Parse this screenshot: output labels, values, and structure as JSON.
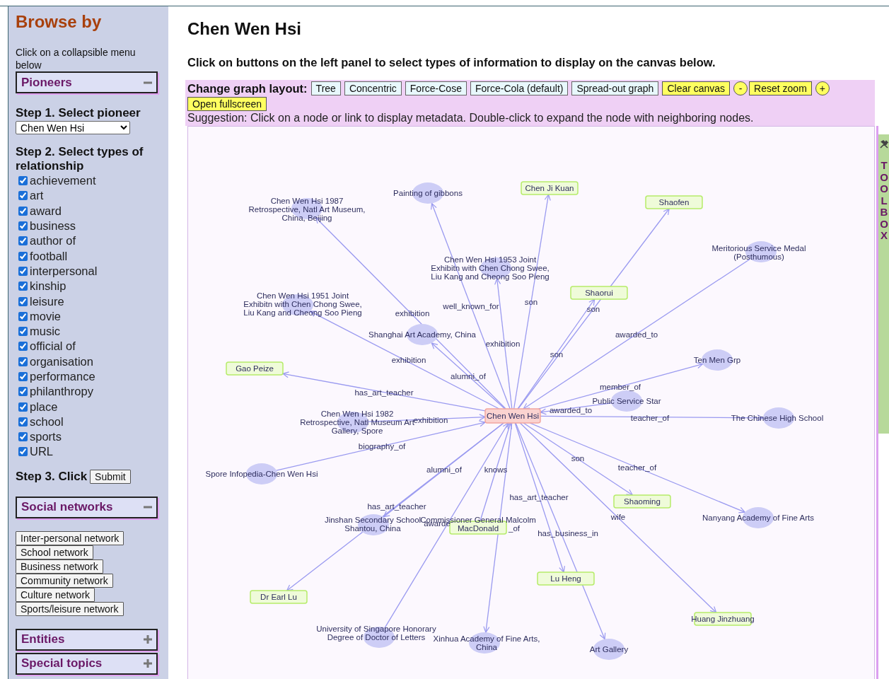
{
  "sidebar": {
    "title": "Browse by",
    "hint": "Click on a collapsible menu below",
    "pioneers_menu": {
      "title": "Pioneers",
      "expanded": true
    },
    "step1": {
      "label": "Step 1. Select pioneer",
      "pioneer": "Chen Wen Hsi"
    },
    "step2": {
      "label": "Step 2. Select types of relationship",
      "relationships": [
        {
          "label": "achievement",
          "checked": true
        },
        {
          "label": "art",
          "checked": true
        },
        {
          "label": "award",
          "checked": true
        },
        {
          "label": "business",
          "checked": true
        },
        {
          "label": "author of",
          "checked": true
        },
        {
          "label": "football",
          "checked": true
        },
        {
          "label": "interpersonal",
          "checked": true
        },
        {
          "label": "kinship",
          "checked": true
        },
        {
          "label": "leisure",
          "checked": true
        },
        {
          "label": "movie",
          "checked": true
        },
        {
          "label": "music",
          "checked": true
        },
        {
          "label": "official of",
          "checked": true
        },
        {
          "label": "organisation",
          "checked": true
        },
        {
          "label": "performance",
          "checked": true
        },
        {
          "label": "philanthropy",
          "checked": true
        },
        {
          "label": "place",
          "checked": true
        },
        {
          "label": "school",
          "checked": true
        },
        {
          "label": "sports",
          "checked": true
        },
        {
          "label": "URL",
          "checked": true
        }
      ]
    },
    "step3": {
      "label": "Step 3. Click",
      "button": "Submit"
    },
    "social_menu": {
      "title": "Social networks",
      "expanded": true
    },
    "networks": [
      "Inter-personal network",
      "School network",
      "Business network",
      "Community network",
      "Culture network",
      "Sports/leisure network"
    ],
    "other_menus": [
      {
        "title": "Entities",
        "expanded": false
      },
      {
        "title": "Special topics",
        "expanded": false
      }
    ]
  },
  "main": {
    "title": "Chen Wen Hsi",
    "instruction": "Click on buttons on the left panel to select types of information to display on the canvas below.",
    "layout_bar": {
      "label": "Change graph layout:",
      "buttons": [
        {
          "label": "Tree",
          "kind": "layout"
        },
        {
          "label": "Concentric",
          "kind": "layout"
        },
        {
          "label": "Force-Cose",
          "kind": "layout"
        },
        {
          "label": "Force-Cola (default)",
          "kind": "layout"
        },
        {
          "label": "Spread-out graph",
          "kind": "layout"
        },
        {
          "label": "Clear canvas",
          "kind": "action"
        },
        {
          "label": "-",
          "kind": "zoom"
        },
        {
          "label": "Reset zoom",
          "kind": "action"
        },
        {
          "label": "+",
          "kind": "zoom"
        },
        {
          "label": "Open fullscreen",
          "kind": "action"
        }
      ]
    },
    "suggestion": "Suggestion: Click on a node or link to display metadata. Double-click to expand the node with neighboring nodes.",
    "graph": {
      "nodes": [
        {
          "lines": [
            "Chen Wen Hsi 1987",
            "Retrospective, Natl Art Museum,",
            "China, Beijing"
          ],
          "kind": "entity",
          "edge": {
            "label": "exhibition",
            "kind": "out"
          }
        },
        {
          "lines": [
            "Painting of gibbons"
          ],
          "kind": "entity",
          "edge": {
            "label": "well_known_for",
            "kind": "out"
          }
        },
        {
          "lines": [
            "Chen Ji Kuan"
          ],
          "kind": "person",
          "edge": {
            "label": "son",
            "kind": "out"
          }
        },
        {
          "lines": [
            "Shaofen"
          ],
          "kind": "person",
          "edge": {
            "label": "son",
            "kind": "out"
          }
        },
        {
          "lines": [
            "Chen Wen Hsi 1953 Joint",
            "Exhibitn with Chen Chong Swee,",
            "Liu Kang and Cheong Soo Pieng"
          ],
          "kind": "entity",
          "edge": {
            "label": "exhibition",
            "kind": "out"
          }
        },
        {
          "lines": [
            "Meritorious Service Medal",
            "(Posthumous)"
          ],
          "kind": "entity",
          "edge": {
            "label": "awarded_to",
            "kind": "in"
          }
        },
        {
          "lines": [
            "Chen Wen Hsi 1951 Joint",
            "Exhibitn with Chen Chong Swee,",
            "Liu Kang and Cheong Soo Pieng"
          ],
          "kind": "entity",
          "edge": {
            "label": "exhibition",
            "kind": "out"
          }
        },
        {
          "lines": [
            "Shaorui"
          ],
          "kind": "person",
          "edge": {
            "label": "son",
            "kind": "out"
          }
        },
        {
          "lines": [
            "Shanghai Art Academy, China"
          ],
          "kind": "entity",
          "edge": {
            "label": "alumni_of",
            "kind": "out"
          }
        },
        {
          "lines": [
            "Gao Peize"
          ],
          "kind": "person",
          "edge": {
            "label": "has_art_teacher",
            "kind": "out"
          }
        },
        {
          "lines": [
            "Ten Men Grp"
          ],
          "kind": "entity",
          "edge": {
            "label": "member_of",
            "kind": "out"
          }
        },
        {
          "lines": [
            "Chen Wen Hsi 1982",
            "Retrospective, Natl Museum Art",
            "Gallery, Spore"
          ],
          "kind": "entity",
          "edge": {
            "label": "exhibition",
            "kind": "in"
          }
        },
        {
          "lines": [
            "Chen Wen Hsi"
          ],
          "kind": "focus"
        },
        {
          "lines": [
            "Public Service Star"
          ],
          "kind": "entity",
          "edge": {
            "label": "awarded_to",
            "kind": "in"
          }
        },
        {
          "lines": [
            "The Chinese High School"
          ],
          "kind": "entity",
          "edge": {
            "label": "teacher_of",
            "kind": "out"
          }
        },
        {
          "lines": [
            "Spore Infopedia-Chen Wen Hsi"
          ],
          "kind": "entity",
          "edge": {
            "label": "biography_of",
            "kind": "in"
          }
        },
        {
          "lines": [
            "Jinshan Secondary School",
            "Shantou, China"
          ],
          "kind": "entity",
          "edge": {
            "label": "alumni_of",
            "kind": "out"
          }
        },
        {
          "lines": [
            "Commissioner General Malcolm",
            "MacDonald"
          ],
          "kind": "person",
          "edge": {
            "label": "knows",
            "kind": "in"
          }
        },
        {
          "lines": [
            "Shaoming"
          ],
          "kind": "person",
          "edge": {
            "label": "son",
            "kind": "out"
          }
        },
        {
          "lines": [
            "Nanyang Academy of Fine Arts"
          ],
          "kind": "entity",
          "edge": {
            "label": "teacher_of",
            "kind": "out"
          }
        },
        {
          "lines": [
            "Dr Earl Lu"
          ],
          "kind": "person",
          "edge": {
            "label": "has_art_teacher",
            "kind": "out"
          }
        },
        {
          "lines": [
            "Lu Heng"
          ],
          "kind": "person",
          "edge": {
            "label": "has_art_teacher",
            "kind": "out"
          }
        },
        {
          "lines": [
            "University of Singapore Honorary",
            "Degree of Doctor of Letters"
          ],
          "kind": "entity",
          "edge": {
            "label": "awarde",
            "kind": "in"
          }
        },
        {
          "lines": [
            "Xinhua Academy of Fine Arts,",
            "China"
          ],
          "kind": "entity",
          "edge": {
            "label": "_of",
            "kind": "out"
          }
        },
        {
          "lines": [
            "Art Gallery"
          ],
          "kind": "entity",
          "edge": {
            "label": "has_business_in",
            "kind": "out"
          }
        },
        {
          "lines": [
            "Huang Jinzhuang"
          ],
          "kind": "person",
          "edge": {
            "label": "wife",
            "kind": "out"
          }
        }
      ]
    },
    "toolbox": {
      "label": "TOOLBOX"
    }
  }
}
